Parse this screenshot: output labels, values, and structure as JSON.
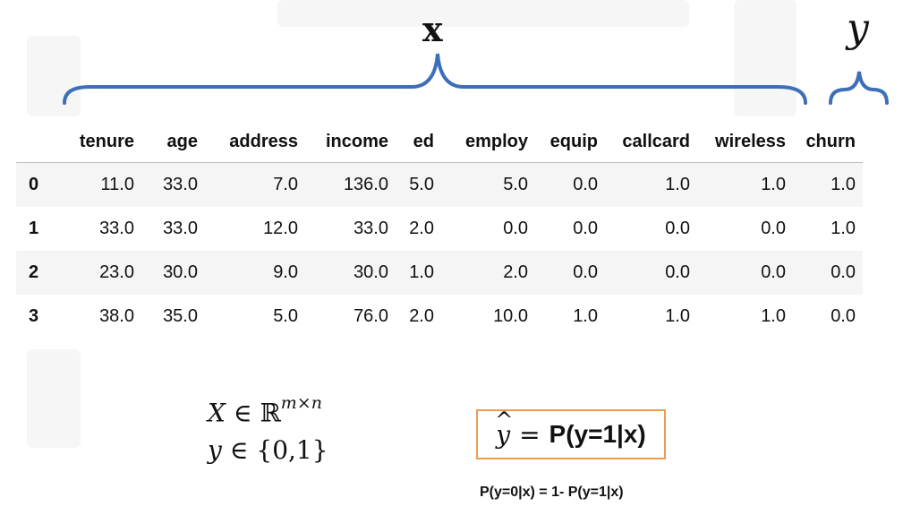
{
  "labels": {
    "x": "x",
    "y": "y"
  },
  "table": {
    "columns": [
      "tenure",
      "age",
      "address",
      "income",
      "ed",
      "employ",
      "equip",
      "callcard",
      "wireless",
      "churn"
    ],
    "rows": [
      {
        "index": "0",
        "values": [
          "11.0",
          "33.0",
          "7.0",
          "136.0",
          "5.0",
          "5.0",
          "0.0",
          "1.0",
          "1.0",
          "1.0"
        ]
      },
      {
        "index": "1",
        "values": [
          "33.0",
          "33.0",
          "12.0",
          "33.0",
          "2.0",
          "0.0",
          "0.0",
          "0.0",
          "0.0",
          "1.0"
        ]
      },
      {
        "index": "2",
        "values": [
          "23.0",
          "30.0",
          "9.0",
          "30.0",
          "1.0",
          "2.0",
          "0.0",
          "0.0",
          "0.0",
          "0.0"
        ]
      },
      {
        "index": "3",
        "values": [
          "38.0",
          "35.0",
          "5.0",
          "76.0",
          "2.0",
          "10.0",
          "1.0",
          "1.0",
          "1.0",
          "0.0"
        ]
      }
    ]
  },
  "math": {
    "x_var": "X",
    "x_in": "∈",
    "x_set": "ℝ",
    "x_sup": "m×n",
    "y_var": "y",
    "y_in": "∈",
    "y_set": "{0,1}"
  },
  "box": {
    "yhat": "y",
    "hat": "^",
    "eq": "=",
    "expr": "P(y=1|x)"
  },
  "note": "P(y=0|x) = 1- P(y=1|x)",
  "colors": {
    "brace": "#3d6fb8",
    "box_border": "#ee9b55",
    "row_stripe": "#f5f5f5"
  }
}
